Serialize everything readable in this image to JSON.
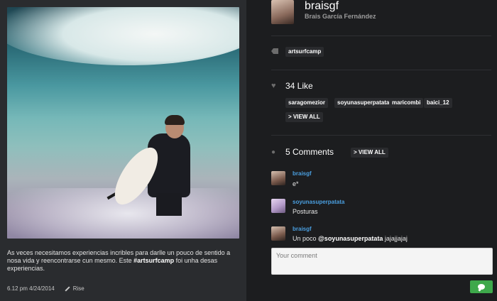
{
  "post": {
    "caption_pre": "As veces necesitamos experiencias incribles para darlle un pouco de sentido a nosa vida y reencontrarse cun mesmo. Este ",
    "caption_tag": "#artsurfcamp",
    "caption_post": " foi unha desas experiencias.",
    "timestamp": "6.12 pm 4/24/2014",
    "edit_label": "Rise"
  },
  "author": {
    "username": "braisgf",
    "full_name": "Brais García Fernández"
  },
  "tags": [
    "artsurfcamp"
  ],
  "likes": {
    "label": "34 Like",
    "users": [
      "saragomezior",
      "soyunasuperpatata",
      "maricombi",
      "baici_12"
    ],
    "view_all": "> VIEW ALL"
  },
  "comments": {
    "label": "5 Comments",
    "view_all": "> VIEW ALL",
    "items": [
      {
        "user": "braisgf",
        "text": "e*"
      },
      {
        "user": "soyunasuperpatata",
        "text": "Posturas"
      },
      {
        "user": "braisgf",
        "text_pre": "Un poco ",
        "mention": "@soyunasuperpatata",
        "text_post": " jajajjajaj"
      }
    ],
    "placeholder": "Your comment"
  },
  "icons": {
    "tag": "tag-icon",
    "like": "heart-icon",
    "comments": "speech-bubble-icon",
    "edit": "pencil-icon",
    "send": "send-comment-icon"
  },
  "colors": {
    "accent_link": "#4a9fe0",
    "send_button": "#3ea84b"
  }
}
